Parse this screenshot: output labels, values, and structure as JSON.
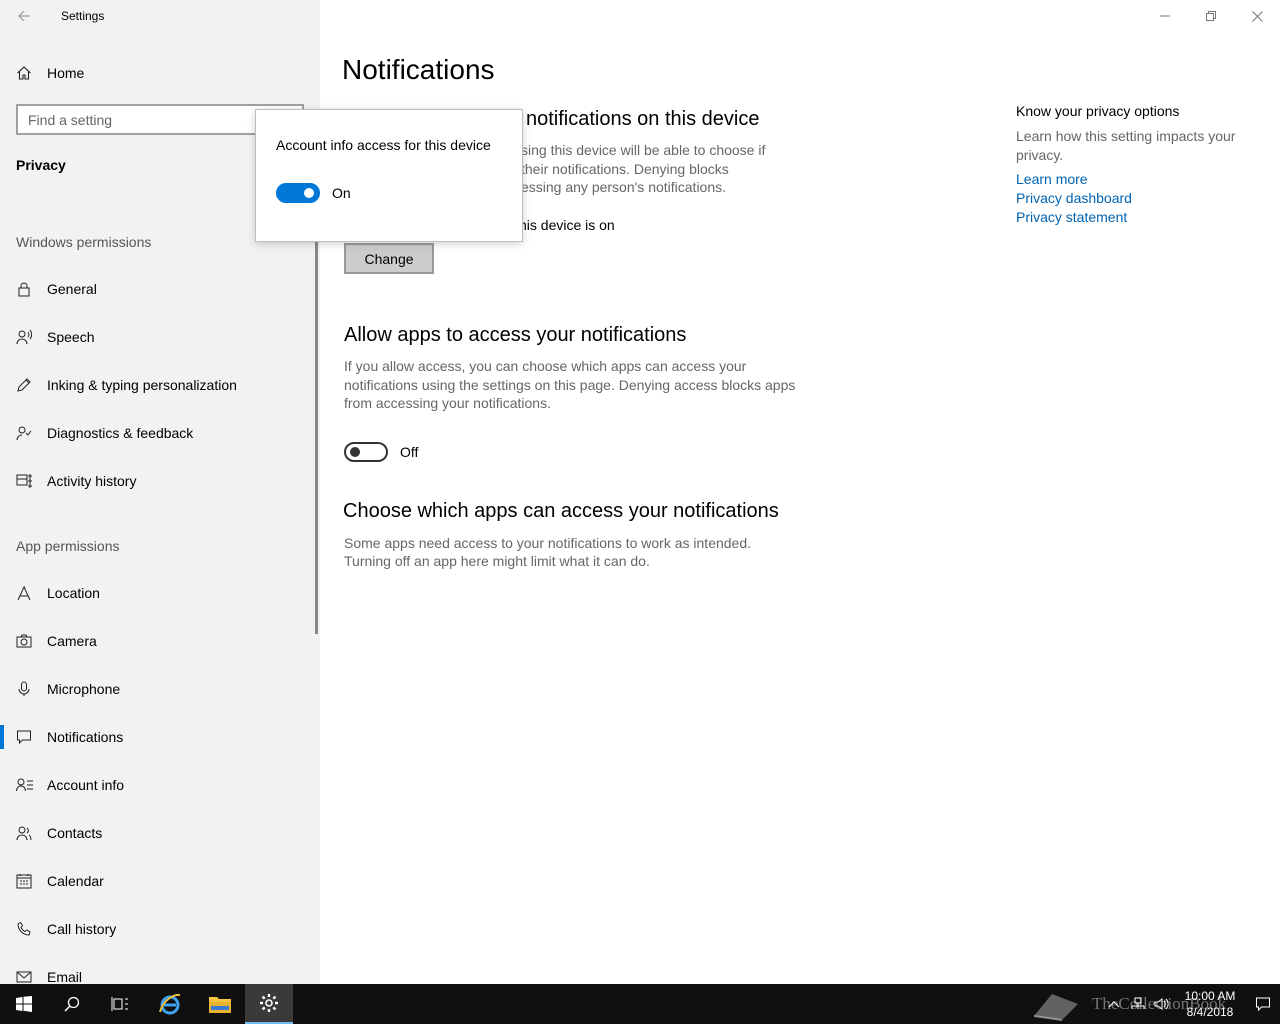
{
  "window": {
    "app_title": "Settings",
    "back_label": "Back",
    "minimize_label": "Minimize",
    "restore_label": "Restore",
    "close_label": "Close"
  },
  "sidebar": {
    "home_label": "Home",
    "search_placeholder": "Find a setting",
    "section_title": "Privacy",
    "windows_permissions_label": "Windows permissions",
    "app_permissions_label": "App permissions",
    "windows_items": [
      {
        "label": "General",
        "icon": "lock-icon"
      },
      {
        "label": "Speech",
        "icon": "speech-icon"
      },
      {
        "label": "Inking & typing personalization",
        "icon": "pen-icon"
      },
      {
        "label": "Diagnostics & feedback",
        "icon": "feedback-icon"
      },
      {
        "label": "Activity history",
        "icon": "activity-icon"
      }
    ],
    "app_items": [
      {
        "label": "Location",
        "icon": "location-icon"
      },
      {
        "label": "Camera",
        "icon": "camera-icon"
      },
      {
        "label": "Microphone",
        "icon": "microphone-icon"
      },
      {
        "label": "Notifications",
        "icon": "notifications-icon",
        "active": true
      },
      {
        "label": "Account info",
        "icon": "account-info-icon"
      },
      {
        "label": "Contacts",
        "icon": "contacts-icon"
      },
      {
        "label": "Calendar",
        "icon": "calendar-icon"
      },
      {
        "label": "Call history",
        "icon": "call-history-icon"
      },
      {
        "label": "Email",
        "icon": "email-icon"
      }
    ]
  },
  "main": {
    "page_title": "Notifications",
    "section1": {
      "heading": "notifications on this device",
      "desc_line1": "sing this device will be able to choose if",
      "desc_line2": "their notifications. Denying blocks",
      "desc_line3": "essing any person's notifications.",
      "status": "his device is on",
      "change_label": "Change"
    },
    "section2": {
      "heading": "Allow apps to access your notifications",
      "desc_line1": "If you allow access, you can choose which apps can access your",
      "desc_line2": "notifications using the settings on this page. Denying access blocks apps",
      "desc_line3": "from accessing your notifications.",
      "toggle_state": "Off"
    },
    "section3": {
      "heading": "Choose which apps can access your notifications",
      "desc_line1": "Some apps need access to your notifications to work as intended.",
      "desc_line2": "Turning off an app here might limit what it can do."
    },
    "privacy": {
      "title": "Know your privacy options",
      "desc": "Learn how this setting impacts your privacy.",
      "links": [
        "Learn more",
        "Privacy dashboard",
        "Privacy statement"
      ]
    }
  },
  "popup": {
    "title": "Account info access for this device",
    "toggle_state": "On"
  },
  "taskbar": {
    "time": "10:00 AM",
    "date": "8/4/2018",
    "watermark": "TheCollectionBook"
  },
  "colors": {
    "accent": "#0078d7",
    "link": "#0063b1",
    "sidebar_bg": "#f2f2f2",
    "taskbar_bg": "#101010"
  }
}
